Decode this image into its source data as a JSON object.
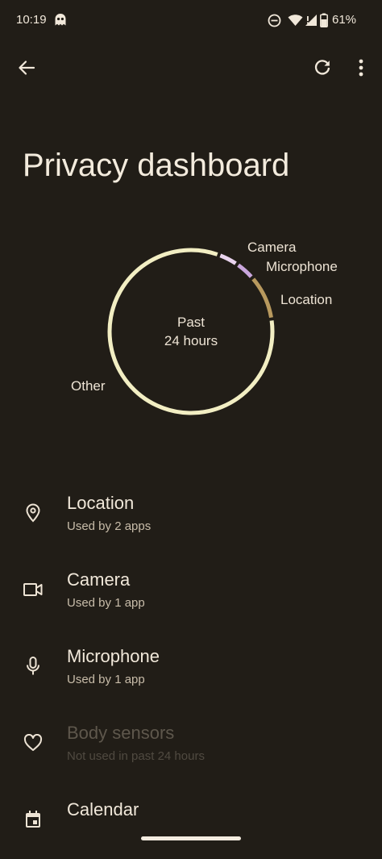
{
  "status_bar": {
    "time": "10:19",
    "battery": "61%"
  },
  "header": {
    "title": "Privacy dashboard",
    "back_icon": "arrow-back-icon",
    "refresh_icon": "refresh-icon",
    "more_icon": "more-vert-icon"
  },
  "chart_data": {
    "type": "pie",
    "center_text": [
      "Past",
      "24 hours"
    ],
    "categories": [
      "Camera",
      "Microphone",
      "Location",
      "Other"
    ],
    "values": [
      4,
      4,
      9,
      83
    ],
    "colors": [
      "#e9d4ee",
      "#c9a6dc",
      "#b8995e",
      "#f2eec3"
    ],
    "title": "",
    "legend": "labels-around-ring"
  },
  "permissions": [
    {
      "title": "Location",
      "subtitle": "Used by 2 apps",
      "icon": "location-pin-icon",
      "enabled": true
    },
    {
      "title": "Camera",
      "subtitle": "Used by 1 app",
      "icon": "videocam-icon",
      "enabled": true
    },
    {
      "title": "Microphone",
      "subtitle": "Used by 1 app",
      "icon": "microphone-icon",
      "enabled": true
    },
    {
      "title": "Body sensors",
      "subtitle": "Not used in past 24 hours",
      "icon": "heart-icon",
      "enabled": false
    },
    {
      "title": "Calendar",
      "subtitle": "",
      "icon": "calendar-icon",
      "enabled": true
    }
  ]
}
